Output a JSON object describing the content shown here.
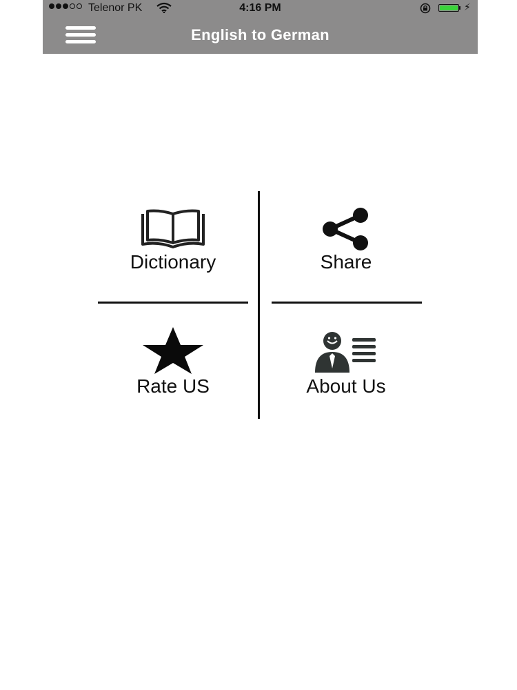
{
  "status_bar": {
    "carrier": "Telenor PK",
    "time": "4:16 PM",
    "signal_bars_filled": 3,
    "signal_bars_total": 5,
    "battery_color": "#3ad33a"
  },
  "header": {
    "title": "English to German",
    "background": "#8c8b8b",
    "menu_icon": "hamburger-menu-icon"
  },
  "menu": {
    "items": [
      {
        "label": "Dictionary",
        "icon": "open-book-icon"
      },
      {
        "label": "Share",
        "icon": "share-icon"
      },
      {
        "label": "Rate US",
        "icon": "star-icon"
      },
      {
        "label": "About Us",
        "icon": "profile-card-icon"
      }
    ]
  }
}
